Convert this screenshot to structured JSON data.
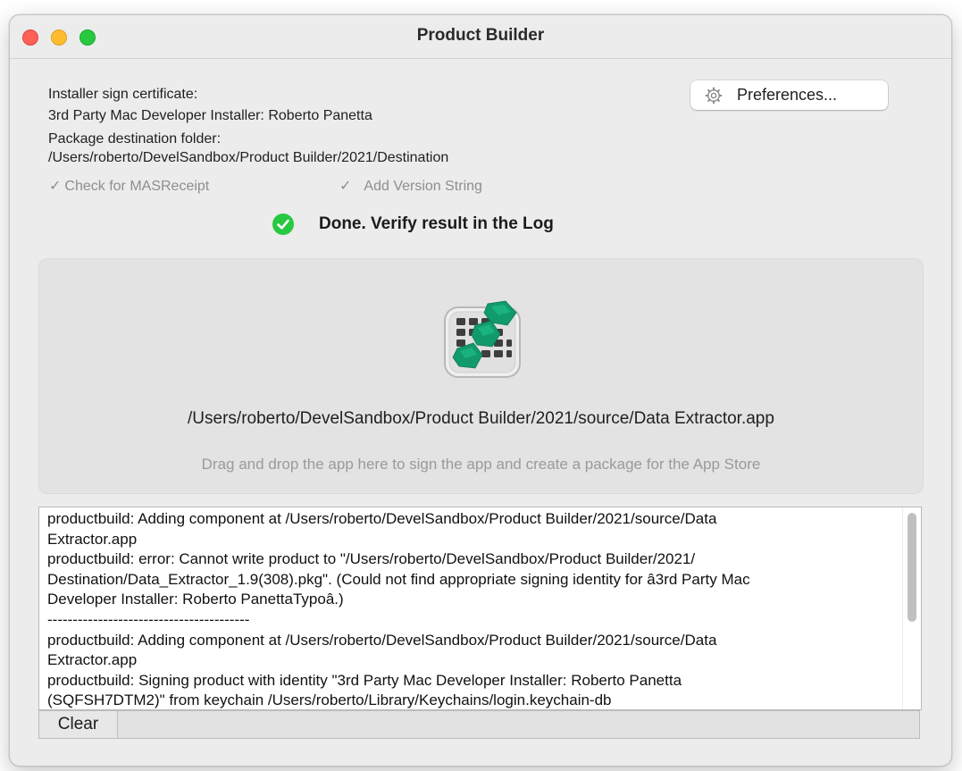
{
  "window": {
    "title": "Product Builder"
  },
  "info": {
    "cert_label": "Installer sign certificate:",
    "cert_value": "3rd Party Mac Developer Installer: Roberto Panetta",
    "dest_label": "Package destination folder:",
    "dest_value": "/Users/roberto/DevelSandbox/Product Builder/2021/Destination"
  },
  "options": {
    "check_mas_mark": "✓",
    "check_mas_label": "Check for MASReceipt",
    "add_version_mark": "✓",
    "add_version_label": "Add Version String"
  },
  "preferences": {
    "label": "Preferences...",
    "icon": "gear-icon"
  },
  "status": {
    "icon": "checkmark-circle-icon",
    "text": "Done. Verify result in the Log",
    "color": "#28c840"
  },
  "drop_zone": {
    "app_icon": "app-grid-icon",
    "path": "/Users/roberto/DevelSandbox/Product Builder/2021/source/Data Extractor.app",
    "hint": "Drag and drop the app here to sign the app and create a package for the App Store"
  },
  "log": {
    "lines": [
      "productbuild: Adding component at /Users/roberto/DevelSandbox/Product Builder/2021/source/Data",
      "Extractor.app",
      "productbuild: error: Cannot write product to \"/Users/roberto/DevelSandbox/Product Builder/2021/",
      "Destination/Data_Extractor_1.9(308).pkg\". (Could not find appropriate signing identity for â3rd Party Mac",
      "Developer Installer: Roberto PanettaTypoâ.)",
      "----------------------------------------",
      "productbuild: Adding component at /Users/roberto/DevelSandbox/Product Builder/2021/source/Data",
      "Extractor.app",
      "productbuild: Signing product with identity \"3rd Party Mac Developer Installer: Roberto Panetta",
      "(SQFSH7DTM2)\" from keychain /Users/roberto/Library/Keychains/login.keychain-db"
    ]
  },
  "footer": {
    "clear_label": "Clear"
  }
}
